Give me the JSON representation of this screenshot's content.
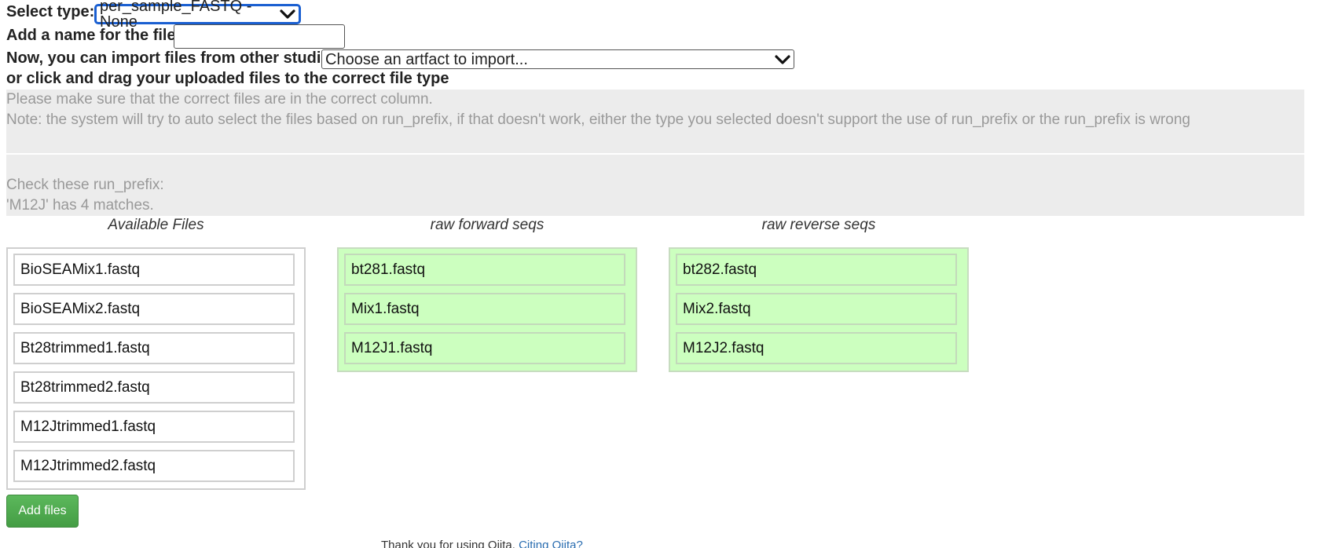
{
  "form": {
    "select_type_label": "Select type:",
    "select_type_value": "per_sample_FASTQ - None",
    "file_name_label": "Add a name for the file:",
    "file_name_value": "",
    "import_label": "Now, you can import files from other studies",
    "import_select_value": "Choose an artfact to import...",
    "drag_instruction": "or click and drag your uploaded files to the correct file type"
  },
  "notes": {
    "line1": "Please make sure that the correct files are in the correct column.",
    "line2": "Note: the system will try to auto select the files based on run_prefix, if that doesn't work, either the type you selected doesn't support the use of run_prefix or the run_prefix is wrong",
    "check_title": "Check these run_prefix:",
    "check_result": "'M12J' has 4 matches."
  },
  "columns": {
    "available": {
      "title": "Available Files",
      "files": [
        "BioSEAMix1.fastq",
        "BioSEAMix2.fastq",
        "Bt28trimmed1.fastq",
        "Bt28trimmed2.fastq",
        "M12Jtrimmed1.fastq",
        "M12Jtrimmed2.fastq"
      ]
    },
    "forward": {
      "title": "raw forward seqs",
      "files": [
        "bt281.fastq",
        "Mix1.fastq",
        "M12J1.fastq"
      ]
    },
    "reverse": {
      "title": "raw reverse seqs",
      "files": [
        "bt282.fastq",
        "Mix2.fastq",
        "M12J2.fastq"
      ]
    }
  },
  "actions": {
    "add_files_label": "Add files"
  },
  "footer": {
    "text": "Thank you for using Qiita.",
    "link": "Citing Qiita?"
  },
  "colors": {
    "green_zone": "#ccffbf",
    "button_green": "#5cb85c",
    "focus_blue": "#1a5fd1",
    "link_blue": "#2a6db0"
  }
}
